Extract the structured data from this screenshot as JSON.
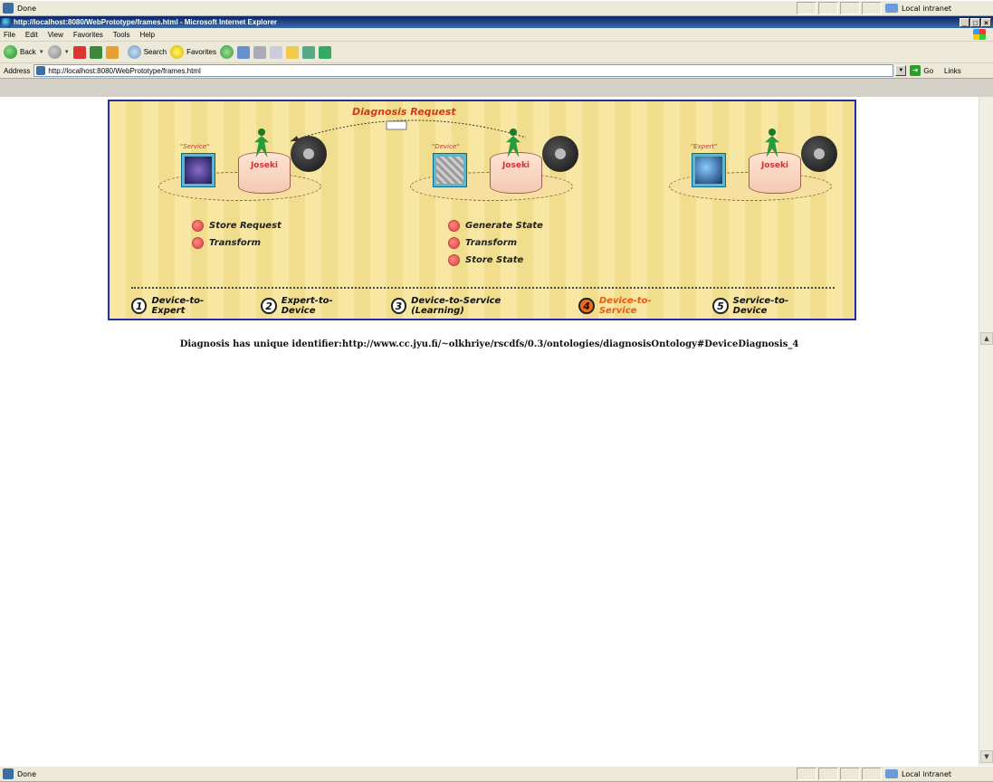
{
  "top_status": {
    "text": "Done",
    "zone": "Local intranet"
  },
  "window": {
    "title": "http://localhost:8080/WebPrototype/frames.html - Microsoft Internet Explorer"
  },
  "menu": [
    "File",
    "Edit",
    "View",
    "Favorites",
    "Tools",
    "Help"
  ],
  "toolbar": {
    "back": "Back",
    "search": "Search",
    "favorites": "Favorites"
  },
  "address": {
    "label": "Address",
    "url": "http://localhost:8080/WebPrototype/frames.html",
    "go": "Go",
    "links": "Links"
  },
  "banner": {
    "title": "Diagnosis Request",
    "nodes": [
      {
        "role": "\"Service\"",
        "server": "Joseki",
        "steps": [
          "Store Request",
          "Transform"
        ]
      },
      {
        "role": "\"Device\"",
        "server": "Joseki",
        "steps": [
          "Generate State",
          "Transform",
          "Store State"
        ]
      },
      {
        "role": "\"Expert\"",
        "server": "Joseki",
        "steps": []
      }
    ],
    "tabs": [
      {
        "num": "1",
        "label": "Device-to-Expert"
      },
      {
        "num": "2",
        "label": "Expert-to-Device"
      },
      {
        "num": "3",
        "label": "Device-to-Service (Learning)"
      },
      {
        "num": "4",
        "label": "Device-to-Service",
        "active": true
      },
      {
        "num": "5",
        "label": "Service-to-Device"
      }
    ]
  },
  "message": "Diagnosis has unique identifier:http://www.cc.jyu.fi/~olkhriye/rscdfs/0.3/ontologies/diagnosisOntology#DeviceDiagnosis_4",
  "bottom_status": {
    "text": "Done",
    "zone": "Local intranet"
  },
  "colors": {
    "accent": "#e85a10",
    "banner_border": "#2230a0",
    "title_red": "#d33a1a"
  }
}
